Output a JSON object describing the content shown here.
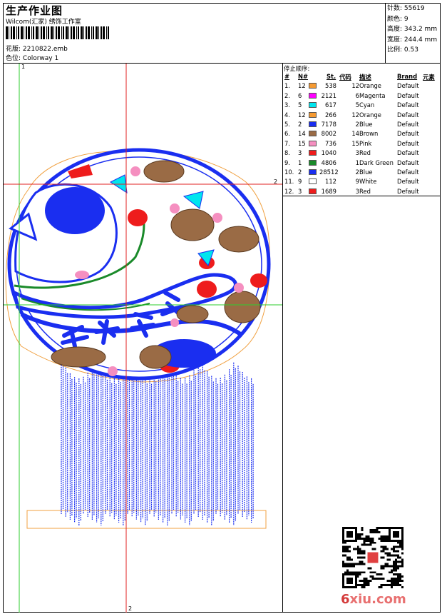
{
  "header": {
    "title": "生产作业图",
    "company": "Wilcom(汇家) 绣饰工作室",
    "design_label": "花版:",
    "design_file": "2210822.emb",
    "color_label": "色位:",
    "colorway": "Colorway 1"
  },
  "stats": [
    {
      "label": "针数:",
      "value": "55619"
    },
    {
      "label": "颜色:",
      "value": "9"
    },
    {
      "label": "高度:",
      "value": "343.2 mm"
    },
    {
      "label": "宽度:",
      "value": "244.4 mm"
    },
    {
      "label": "比例:",
      "value": "0.53"
    }
  ],
  "stop_sequence": {
    "caption": "停止顺序:",
    "columns": [
      "#",
      "N#",
      "St.",
      "代码",
      "描述",
      "Brand",
      "元素"
    ],
    "rows": [
      {
        "idx": "1.",
        "n": "12",
        "color": "#f59a32",
        "st": "538",
        "code": "12",
        "desc": "Orange",
        "brand": "Default"
      },
      {
        "idx": "2.",
        "n": "6",
        "color": "#ff00ff",
        "st": "2121",
        "code": "6",
        "desc": "Magenta",
        "brand": "Default"
      },
      {
        "idx": "3.",
        "n": "5",
        "color": "#00e5ee",
        "st": "617",
        "code": "5",
        "desc": "Cyan",
        "brand": "Default"
      },
      {
        "idx": "4.",
        "n": "12",
        "color": "#f59a32",
        "st": "266",
        "code": "12",
        "desc": "Orange",
        "brand": "Default"
      },
      {
        "idx": "5.",
        "n": "2",
        "color": "#1a2ef0",
        "st": "7178",
        "code": "2",
        "desc": "Blue",
        "brand": "Default"
      },
      {
        "idx": "6.",
        "n": "14",
        "color": "#9a6b45",
        "st": "8002",
        "code": "14",
        "desc": "Brown",
        "brand": "Default"
      },
      {
        "idx": "7.",
        "n": "15",
        "color": "#f58fc0",
        "st": "736",
        "code": "15",
        "desc": "Pink",
        "brand": "Default"
      },
      {
        "idx": "8.",
        "n": "3",
        "color": "#ee1c1c",
        "st": "1040",
        "code": "3",
        "desc": "Red",
        "brand": "Default"
      },
      {
        "idx": "9.",
        "n": "1",
        "color": "#1a8a2a",
        "st": "4806",
        "code": "1",
        "desc": "Dark Green",
        "brand": "Default"
      },
      {
        "idx": "10.",
        "n": "2",
        "color": "#1a2ef0",
        "st": "28512",
        "code": "2",
        "desc": "Blue",
        "brand": "Default"
      },
      {
        "idx": "11.",
        "n": "9",
        "color": "#ffffff",
        "st": "112",
        "code": "9",
        "desc": "White",
        "brand": "Default"
      },
      {
        "idx": "12.",
        "n": "3",
        "color": "#ee1c1c",
        "st": "1689",
        "code": "3",
        "desc": "Red",
        "brand": "Default"
      }
    ]
  },
  "guides": {
    "mark_1": "1",
    "mark_2": "2",
    "mark_2_bottom": "2"
  },
  "watermark": {
    "prefix": "6",
    "rest": "xiu.com"
  }
}
